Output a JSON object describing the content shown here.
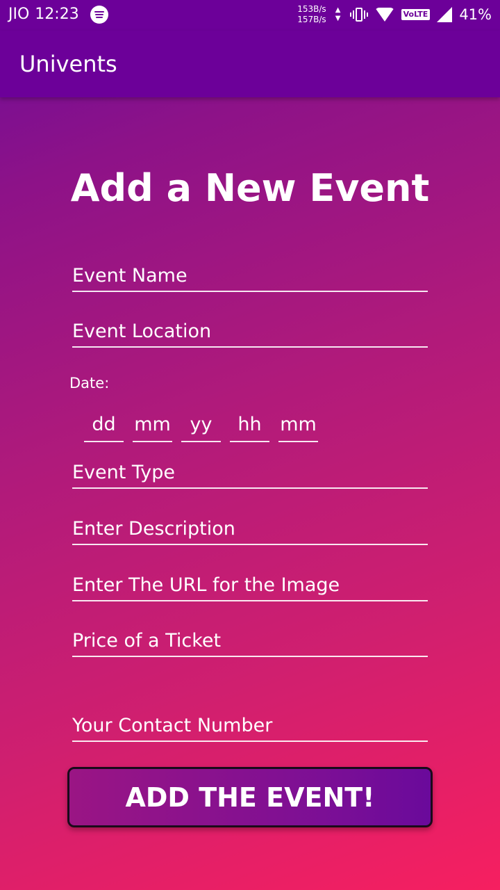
{
  "status_bar": {
    "carrier": "JIO",
    "time": "12:23",
    "net_speed_up": "153B/s",
    "net_speed_down": "157B/s",
    "volte": "VoLTE",
    "battery": "41%",
    "icons": [
      "spotify-icon",
      "data-transfer-icon",
      "vibrate-icon",
      "wifi-icon",
      "volte-icon",
      "signal-icon"
    ]
  },
  "app_bar": {
    "title": "Univents"
  },
  "form": {
    "title": "Add a New Event",
    "event_name_placeholder": "Event Name",
    "event_location_placeholder": "Event Location",
    "date_label": "Date:",
    "date_fields": {
      "day": "dd",
      "month": "mm",
      "year": "yy",
      "hour": "hh",
      "minute": "mm"
    },
    "event_type_placeholder": "Event Type",
    "description_placeholder": "Enter Description",
    "image_url_placeholder": "Enter The URL for the Image",
    "price_placeholder": "Price of a Ticket",
    "contact_placeholder": "Your Contact Number",
    "submit_label": "ADD THE EVENT!"
  },
  "colors": {
    "app_bar": "#6c0099",
    "gradient_start": "#6c0d99",
    "gradient_end": "#f61f60"
  }
}
